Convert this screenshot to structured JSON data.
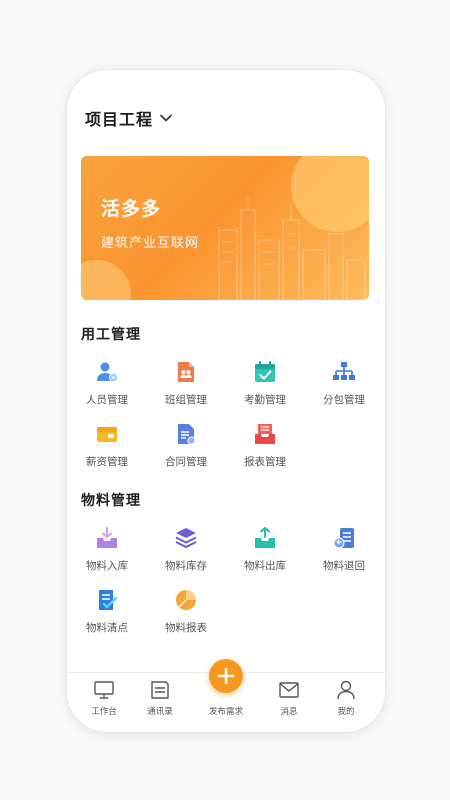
{
  "header": {
    "title": "项目工程"
  },
  "banner": {
    "title": "活多多",
    "subtitle": "建筑产业互联网"
  },
  "sections": {
    "labor": {
      "title": "用工管理",
      "items": [
        "人员管理",
        "班组管理",
        "考勤管理",
        "分包管理",
        "薪资管理",
        "合同管理",
        "报表管理"
      ]
    },
    "material": {
      "title": "物料管理",
      "items": [
        "物料入库",
        "物料库存",
        "物料出库",
        "物料退回",
        "物料清点",
        "物料报表"
      ]
    }
  },
  "tabbar": {
    "items": [
      "工作台",
      "通讯录",
      "发布需求",
      "消息",
      "我的"
    ]
  },
  "colors": {
    "accent": "#f59a1e",
    "banner_start": "#f8a33d",
    "banner_end": "#fdbb5c"
  }
}
